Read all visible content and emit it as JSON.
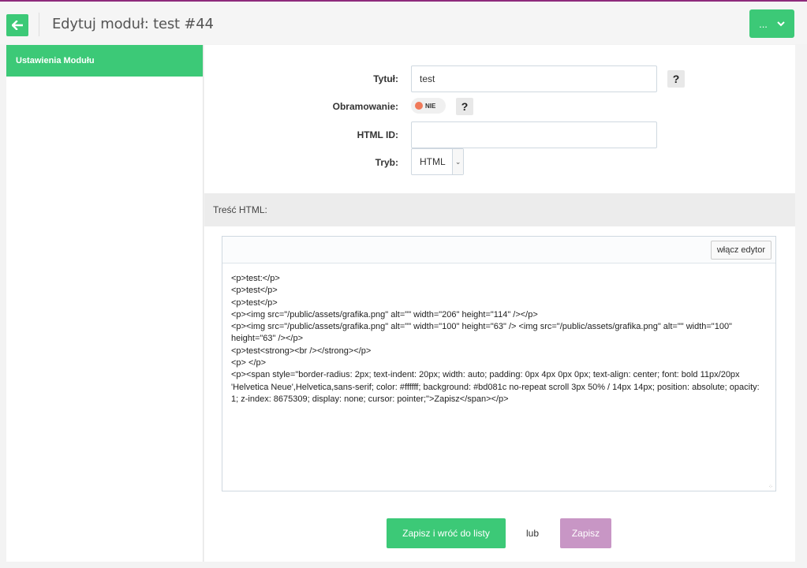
{
  "header": {
    "title": "Edytuj moduł: test #44",
    "more_label": "...",
    "accent_color": "#3cc977",
    "back_icon": "arrow-left-icon"
  },
  "sidebar": {
    "items": [
      {
        "label": "Ustawienia Modułu",
        "active": true
      }
    ]
  },
  "form": {
    "title_label": "Tytuł:",
    "title_value": "test",
    "border_label": "Obramowanie:",
    "border_toggle": "NIE",
    "html_id_label": "HTML ID:",
    "html_id_value": "",
    "mode_label": "Tryb:",
    "mode_value": "HTML",
    "help": "?"
  },
  "content": {
    "section_label": "Treść HTML:",
    "editor_button": "włącz edytor",
    "code_lines": [
      "<p>test:</p>",
      "<p>test</p>",
      "<p>test</p>",
      "<p><img src=\"/public/assets/grafika.png\" alt=\"\" width=\"206\" height=\"114\" /></p>",
      "<p><img src=\"/public/assets/grafika.png\" alt=\"\" width=\"100\" height=\"63\" /> <img src=\"/public/assets/grafika.png\" alt=\"\" width=\"100\" height=\"63\" /></p>",
      "<p>test<strong><br /></strong></p>",
      "<p> </p>",
      "<p><span style=\"border-radius: 2px; text-indent: 20px; width: auto; padding: 0px 4px 0px 0px; text-align: center; font: bold 11px/20px 'Helvetica Neue',Helvetica,sans-serif; color: #ffffff; background: #bd081c  no-repeat scroll 3px 50% / 14px 14px; position: absolute; opacity: 1; z-index: 8675309; display: none; cursor: pointer;\">Zapisz</span></p>"
    ]
  },
  "actions": {
    "save_back_label": "Zapisz i wróć do listy",
    "or_label": "lub",
    "save_label": "Zapisz"
  }
}
